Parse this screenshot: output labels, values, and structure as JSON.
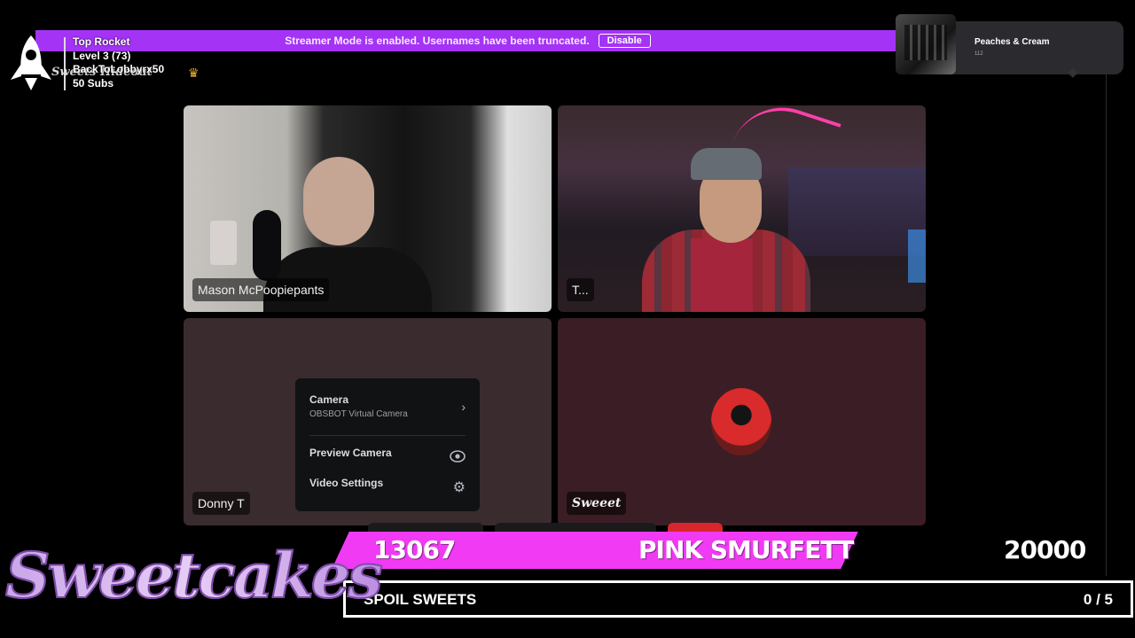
{
  "banner": {
    "text": "Streamer Mode is enabled. Usernames have been truncated.",
    "button": "Disable"
  },
  "server": {
    "name": "Sweets Hideout"
  },
  "rocket_widget": {
    "line1": "Top Rocket",
    "line2": "Level 3  (73)",
    "line3": "BackToLobbyrx50",
    "line4": "50 Subs"
  },
  "now_playing": {
    "title": "Peaches & Cream",
    "subtitle": "112"
  },
  "tiles": [
    {
      "name": "Mason McPoopiepants"
    },
    {
      "name": "T..."
    },
    {
      "name": "Donny T"
    },
    {
      "name": "Sweeet"
    }
  ],
  "menu": {
    "camera_label": "Camera",
    "camera_device": "OBSBOT Virtual Camera",
    "preview_label": "Preview Camera",
    "settings_label": "Video Settings"
  },
  "overlay": {
    "left_count": "13067",
    "pink_name": "PINK SMURFETT",
    "goal": "20000",
    "spoil_label": "SPOIL SWEETS",
    "spoil_count": "0 / 5",
    "logo": "Sweetcakes"
  },
  "colors": {
    "banner": "#a433f6",
    "pink_bar": "#f03af4",
    "menu_bg": "#111214"
  },
  "icons": [
    "rocket-icon",
    "crown-icon",
    "chevron-right-icon",
    "eye-icon",
    "gear-icon"
  ]
}
